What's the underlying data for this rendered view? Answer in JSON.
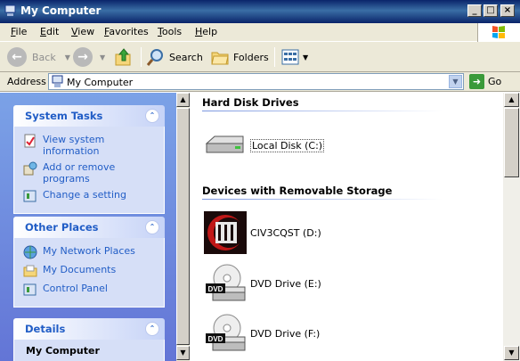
{
  "window": {
    "title": "My Computer"
  },
  "menu": {
    "items": [
      {
        "label": "File",
        "key": "F",
        "rest": "ile"
      },
      {
        "label": "Edit",
        "key": "E",
        "rest": "dit"
      },
      {
        "label": "View",
        "key": "V",
        "rest": "iew"
      },
      {
        "label": "Favorites",
        "key": "F",
        "rest": "avorites"
      },
      {
        "label": "Tools",
        "key": "T",
        "rest": "ools"
      },
      {
        "label": "Help",
        "key": "H",
        "rest": "elp"
      }
    ]
  },
  "toolbar": {
    "back_label": "Back",
    "search_label": "Search",
    "folders_label": "Folders"
  },
  "address": {
    "label": "Address",
    "value": "My Computer",
    "go_label": "Go"
  },
  "sidebar": {
    "system_tasks": {
      "title": "System Tasks",
      "items": [
        {
          "label": "View system information",
          "icon": "system-info-icon"
        },
        {
          "label": "Add or remove programs",
          "icon": "add-remove-programs-icon"
        },
        {
          "label": "Change a setting",
          "icon": "control-panel-icon"
        }
      ]
    },
    "other_places": {
      "title": "Other Places",
      "items": [
        {
          "label": "My Network Places",
          "icon": "network-places-icon"
        },
        {
          "label": "My Documents",
          "icon": "my-documents-icon"
        },
        {
          "label": "Control Panel",
          "icon": "control-panel-icon"
        }
      ]
    },
    "details": {
      "title": "Details",
      "name": "My Computer"
    }
  },
  "content": {
    "groups": [
      {
        "title": "Hard Disk Drives",
        "items": [
          {
            "label": "Local Disk (C:)",
            "icon": "hard-disk-icon"
          }
        ]
      },
      {
        "title": "Devices with Removable Storage",
        "items": [
          {
            "label": "CIV3CQST (D:)",
            "icon": "cd-autorun-icon"
          },
          {
            "label": "DVD Drive (E:)",
            "icon": "dvd-drive-icon"
          },
          {
            "label": "DVD Drive (F:)",
            "icon": "dvd-drive-icon"
          }
        ]
      }
    ]
  },
  "colors": {
    "titlebar": "#0a246a",
    "link": "#215dc6",
    "sidebar_bg": "#7ba2e7",
    "panel_body": "#d6dff7"
  }
}
